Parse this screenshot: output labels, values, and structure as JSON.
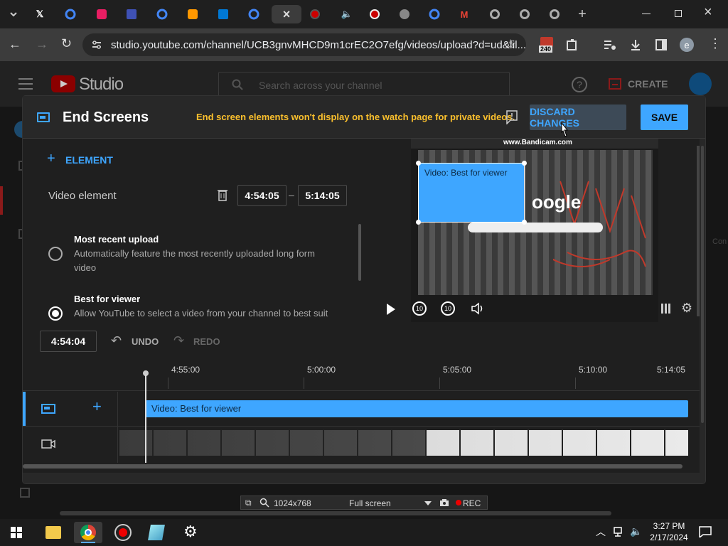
{
  "browser": {
    "url": "studio.youtube.com/channel/UCB3gnvMHCD9m1crEC2O7efg/videos/upload?d=ud&fil...",
    "extension_badge": "240",
    "profile_initial": "e"
  },
  "studio": {
    "brand": "Studio",
    "search_placeholder": "Search across your channel",
    "create_label": "CREATE"
  },
  "modal": {
    "title": "End Screens",
    "warning": "End screen elements won't display on the watch page for private videos.",
    "discard_label": "DISCARD CHANGES",
    "save_label": "SAVE"
  },
  "editor": {
    "add_element_label": "ELEMENT",
    "element_name": "Video element",
    "start_time": "4:54:05",
    "dash": "–",
    "end_time": "5:14:05",
    "options": [
      {
        "title": "Most recent upload",
        "desc": "Automatically feature the most recently uploaded long form video",
        "selected": false
      },
      {
        "title": "Best for viewer",
        "desc": "Allow YouTube to select a video from your channel to best suit",
        "selected": true
      }
    ]
  },
  "preview": {
    "overlay_label": "Video: Best for viewer",
    "watermark": "www.Bandicam.com"
  },
  "timeline": {
    "current_time": "4:54:04",
    "undo_label": "UNDO",
    "redo_label": "REDO",
    "ticks": [
      "4:55:00",
      "5:00:00",
      "5:05:00",
      "5:10:00",
      "5:14:05"
    ],
    "track_label": "Video: Best for viewer"
  },
  "recorder": {
    "resolution": "1024x768",
    "mode": "Full screen",
    "rec_label": "REC"
  },
  "taskbar": {
    "time": "3:27 PM",
    "date": "2/17/2024"
  },
  "colors": {
    "accent": "#3ea6ff",
    "warning": "#fbc02d",
    "youtube_red": "#ff0000"
  }
}
